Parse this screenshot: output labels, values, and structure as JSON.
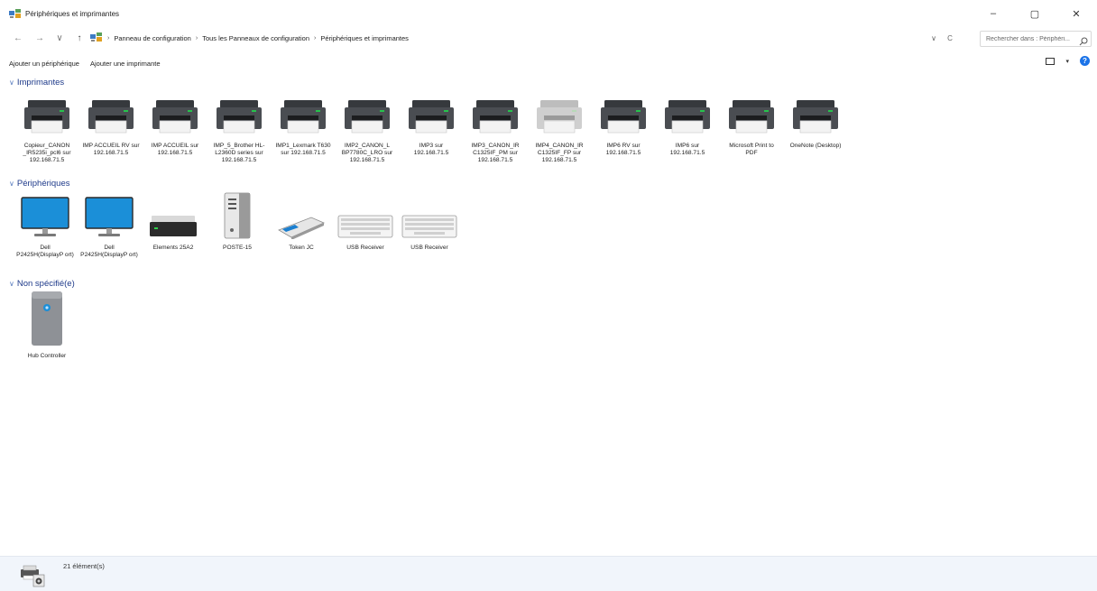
{
  "window": {
    "title": "Périphériques et imprimantes",
    "controls": {
      "minimize": "–",
      "maximize": "▢",
      "close": "✕"
    }
  },
  "nav": {
    "back": "←",
    "forward": "→",
    "recent": "∨",
    "up": "↑",
    "breadcrumb": [
      "Panneau de configuration",
      "Tous les Panneaux de configuration",
      "Périphériques et imprimantes"
    ],
    "dropdown": "∨",
    "refresh": "C",
    "search_placeholder": "Rechercher dans : Périphéri..."
  },
  "commands": {
    "add_device": "Ajouter un périphérique",
    "add_printer": "Ajouter une imprimante"
  },
  "groups": {
    "printers": {
      "title": "Imprimantes",
      "items": [
        {
          "label": "Copieur_CANON _IR5235i_pcl6 sur 192.168.71.5",
          "dim": false
        },
        {
          "label": "IMP ACCUEIL RV sur 192.168.71.5",
          "dim": false
        },
        {
          "label": "IMP ACCUEIL sur 192.168.71.5",
          "dim": false
        },
        {
          "label": "IMP_5_Brother HL-L2360D series sur 192.168.71.5",
          "dim": false
        },
        {
          "label": "IMP1_Lexmark T630 sur 192.168.71.5",
          "dim": false
        },
        {
          "label": "IMP2_CANON_L BP7780C_LRO sur 192.168.71.5",
          "dim": false
        },
        {
          "label": "IMP3 sur 192.168.71.5",
          "dim": false
        },
        {
          "label": "IMP3_CANON_IR C1325IF_PM sur 192.168.71.5",
          "dim": false
        },
        {
          "label": "IMP4_CANON_IR C1325IF_FP sur 192.168.71.5",
          "dim": true
        },
        {
          "label": "IMP6 RV sur 192.168.71.5",
          "dim": false
        },
        {
          "label": "IMP6 sur 192.168.71.5",
          "dim": false
        },
        {
          "label": "Microsoft Print to PDF",
          "dim": false
        },
        {
          "label": "OneNote (Desktop)",
          "dim": false
        }
      ]
    },
    "devices": {
      "title": "Périphériques",
      "items": [
        {
          "label": "Dell P2425H(DisplayP ort)",
          "icon": "monitor-icon"
        },
        {
          "label": "Dell P2425H(DisplayP ort)",
          "icon": "monitor-icon"
        },
        {
          "label": "Elements 25A2",
          "icon": "external-drive-icon"
        },
        {
          "label": "POSTE-15",
          "icon": "computer-tower-icon"
        },
        {
          "label": "Token JC",
          "icon": "usb-token-icon"
        },
        {
          "label": "USB Receiver",
          "icon": "keyboard-icon"
        },
        {
          "label": "USB Receiver",
          "icon": "keyboard-icon"
        }
      ]
    },
    "unspecified": {
      "title": "Non spécifié(e)",
      "items": [
        {
          "label": "Hub Controller",
          "icon": "hub-controller-icon"
        }
      ]
    }
  },
  "status": {
    "count": "21 élément(s)"
  },
  "colors": {
    "accent": "#1b73e8",
    "group_title": "#1e3a8a",
    "status_bg": "#f1f5fb"
  }
}
